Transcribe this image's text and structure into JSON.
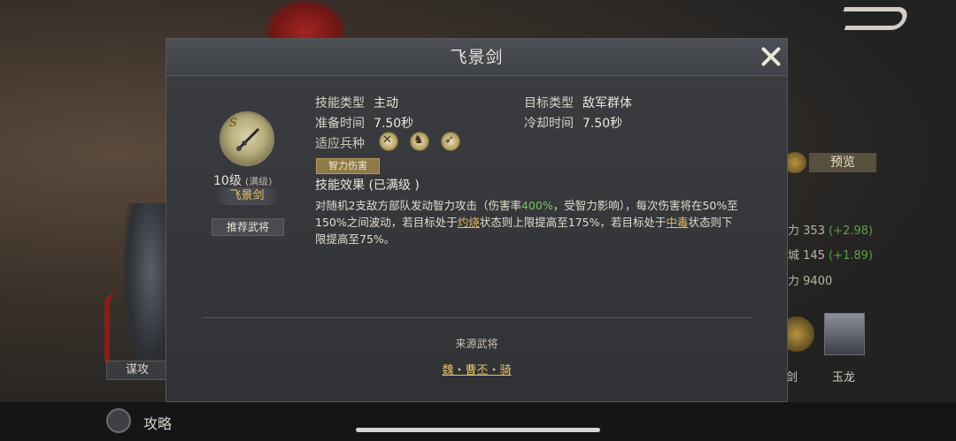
{
  "background": {
    "preview_label": "预览",
    "stats": [
      {
        "label": "力",
        "value": "353",
        "bonus": "(+2.98)"
      },
      {
        "label": "城",
        "value": "145",
        "bonus": "(+1.89)"
      },
      {
        "label": "力",
        "value": "9400",
        "bonus": ""
      }
    ],
    "skill_slot_label": "剑",
    "general_label": "玉龙",
    "strategy_tag": "谋攻",
    "guide_label": "攻略"
  },
  "modal": {
    "title": "飞景剑",
    "skill": {
      "grade": "S",
      "level": "10级",
      "level_state": "(满级)",
      "name": "飞景剑"
    },
    "recommend_button": "推荐武将",
    "info": {
      "skill_type_label": "技能类型",
      "skill_type_value": "主动",
      "target_type_label": "目标类型",
      "target_type_value": "敌军群体",
      "prep_time_label": "准备时间",
      "prep_time_value": "7.50秒",
      "cooldown_label": "冷却时间",
      "cooldown_value": "7.50秒",
      "troops_label": "适应兵种",
      "troop_icons": [
        "crossed-swords-icon",
        "horse-icon",
        "bow-icon"
      ]
    },
    "damage_tag": "智力伤害",
    "effect_title": "技能效果 (已满级 )",
    "effect": {
      "p1": "对随机2支敌方部队发动智力攻击（伤害率",
      "rate": "400%",
      "p2": "，受智力影响），每次伤害将在50%至150%之间波动，若目标处于",
      "burn": "灼烧",
      "p3": "状态则上限提高至175%，若目标处于",
      "poison": "中毒",
      "p4": "状态则下限提高至75%。"
    },
    "source_title": "来源武将",
    "source_general": "魏・曹丕・骑"
  },
  "colors": {
    "gold_text": "#e8c66e",
    "green_text": "#7cc258",
    "modal_bg": "#35373b"
  }
}
